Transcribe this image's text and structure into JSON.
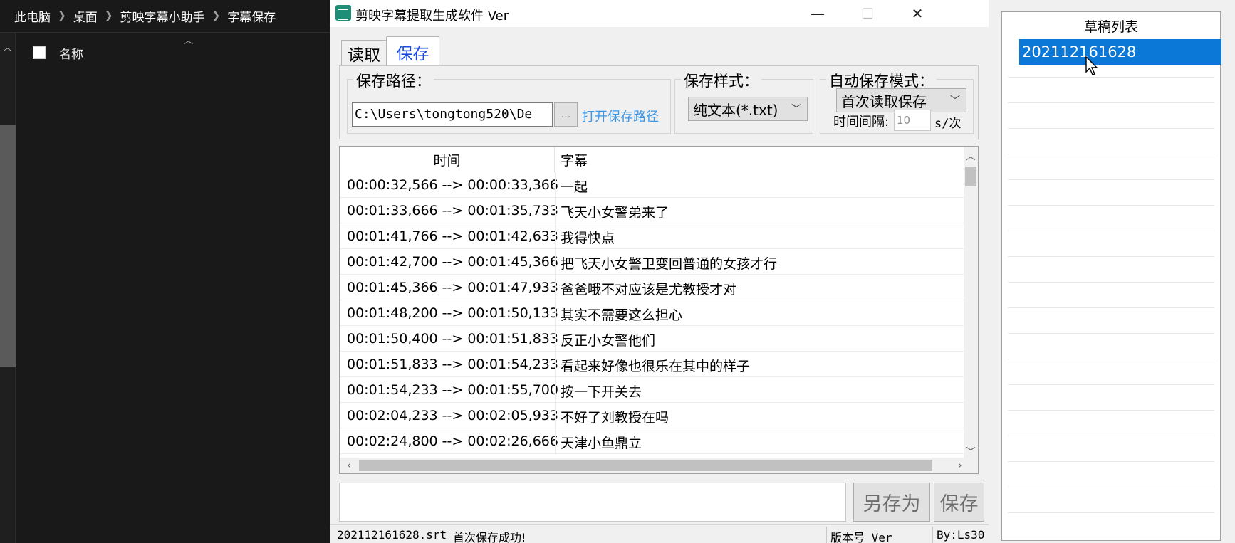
{
  "explorer": {
    "breadcrumb": [
      "此电脑",
      "桌面",
      "剪映字幕小助手",
      "字幕保存"
    ],
    "column_name": "名称"
  },
  "app": {
    "title": "剪映字幕提取生成软件 Ver",
    "tabs": {
      "read": "读取",
      "save": "保存"
    },
    "save_path": {
      "label": "保存路径：",
      "value": "C:\\Users\\tongtong520\\De",
      "browse": "…",
      "open_link": "打开保存路径"
    },
    "save_style": {
      "label": "保存样式：",
      "selected": "纯文本(*.txt)"
    },
    "auto_save": {
      "label": "自动保存模式：",
      "selected": "首次读取保存",
      "interval_label": "时间间隔:",
      "interval_value": "10",
      "interval_unit": "s/次"
    },
    "grid": {
      "columns": [
        "时间",
        "字幕"
      ],
      "rows": [
        {
          "time": "00:00:32,566 --> 00:00:33,366",
          "text": "一起"
        },
        {
          "time": "00:01:33,666 --> 00:01:35,733",
          "text": "飞天小女警弟来了"
        },
        {
          "time": "00:01:41,766 --> 00:01:42,633",
          "text": "我得快点"
        },
        {
          "time": "00:01:42,700 --> 00:01:45,366",
          "text": "把飞天小女警卫变回普通的女孩才行"
        },
        {
          "time": "00:01:45,366 --> 00:01:47,933",
          "text": "爸爸哦不对应该是尤教授才对"
        },
        {
          "time": "00:01:48,200 --> 00:01:50,133",
          "text": "其实不需要这么担心"
        },
        {
          "time": "00:01:50,400 --> 00:01:51,833",
          "text": "反正小女警他们"
        },
        {
          "time": "00:01:51,833 --> 00:01:54,233",
          "text": "看起来好像也很乐在其中的样子"
        },
        {
          "time": "00:01:54,233 --> 00:01:55,700",
          "text": "按一下开关去"
        },
        {
          "time": "00:02:04,233 --> 00:02:05,933",
          "text": "不好了刘教授在吗"
        },
        {
          "time": "00:02:24,800 --> 00:02:26,666",
          "text": "天津小鱼鼎立"
        }
      ]
    },
    "buttons": {
      "save_as": "另存为",
      "save": "保存"
    },
    "status": {
      "file": "202112161628.srt",
      "message": "首次保存成功!",
      "version": "版本号 Ver",
      "author": "By:Ls30"
    }
  },
  "drafts": {
    "title": "草稿列表",
    "selected": "202112161628"
  }
}
